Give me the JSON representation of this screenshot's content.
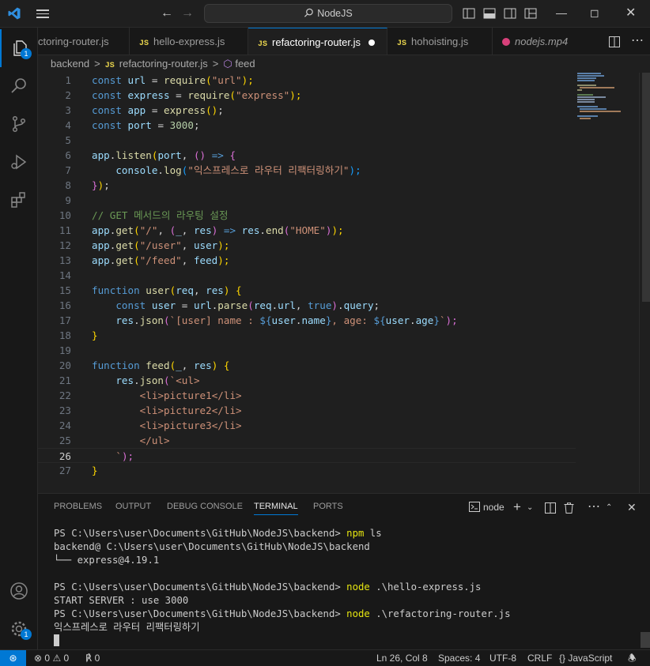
{
  "titlebar": {
    "search_label": "NodeJS",
    "back_icon": "arrow-left-icon",
    "forward_icon": "arrow-right-icon"
  },
  "activity_badges": {
    "explorer": "1",
    "manage": "1"
  },
  "tabs": [
    {
      "label": "ctoring-router.js",
      "icon": "JS"
    },
    {
      "label": "hello-express.js",
      "icon": "JS"
    },
    {
      "label": "refactoring-router.js",
      "icon": "JS"
    },
    {
      "label": "hohoisting.js",
      "icon": "JS"
    },
    {
      "label": "nodejs.mp4",
      "icon": "media"
    }
  ],
  "breadcrumb": {
    "folder": "backend",
    "file": "refactoring-router.js",
    "symbol": "feed",
    "sep": ">"
  },
  "code": {
    "line_numbers": [
      "1",
      "2",
      "3",
      "4",
      "5",
      "6",
      "7",
      "8",
      "9",
      "10",
      "11",
      "12",
      "13",
      "14",
      "15",
      "16",
      "17",
      "18",
      "19",
      "20",
      "21",
      "22",
      "23",
      "24",
      "25",
      "26",
      "27"
    ],
    "l1": {
      "kw": "const",
      "name": "url",
      "op": " = ",
      "fn": "require",
      "open": "(",
      "str": "\"url\"",
      "close": ");"
    },
    "l2": {
      "kw": "const",
      "name": "express",
      "op": " = ",
      "fn": "require",
      "open": "(",
      "str": "\"express\"",
      "close": ");"
    },
    "l3": {
      "kw": "const",
      "name": "app",
      "op": " = ",
      "fn": "express",
      "paren": "()",
      "end": ";"
    },
    "l4": {
      "kw": "const",
      "name": "port",
      "op": " = ",
      "num": "3000",
      "end": ";"
    },
    "l6": {
      "obj": "app",
      "dot": ".",
      "fn": "listen",
      "open": "(",
      "arg": "port",
      "comma": ", ",
      "p2": "()",
      "arrow": " => ",
      "brace": "{"
    },
    "l7": {
      "obj": "console",
      "dot": ".",
      "fn": "log",
      "open": "(",
      "str": "\"익스프레스로 라우터 리팩터링하기\"",
      "close": ");"
    },
    "l8": {
      "brace": "}",
      "paren": ")",
      "end": ";"
    },
    "l10": {
      "comment": "// GET 메서드의 라우팅 설정"
    },
    "l11": {
      "obj": "app",
      "dot": ".",
      "fn": "get",
      "open": "(",
      "str": "\"/\"",
      "comma": ", ",
      "p2o": "(",
      "a1": "_",
      "c2": ", ",
      "a2": "res",
      "p2c": ")",
      "arrow": " => ",
      "o2": "res",
      "dot2": ".",
      "fn2": "end",
      "p3o": "(",
      "str2": "\"HOME\"",
      "p3c": ")",
      "close": ");"
    },
    "l12": {
      "obj": "app",
      "dot": ".",
      "fn": "get",
      "open": "(",
      "str": "\"/user\"",
      "comma": ", ",
      "arg": "user",
      "close": ");"
    },
    "l13": {
      "obj": "app",
      "dot": ".",
      "fn": "get",
      "open": "(",
      "str": "\"/feed\"",
      "comma": ", ",
      "arg": "feed",
      "close": ");"
    },
    "l15": {
      "kw": "function",
      "fn": "user",
      "open": "(",
      "a1": "req",
      "comma": ", ",
      "a2": "res",
      "close": ")",
      "brace": " {"
    },
    "l16": {
      "kw": "const",
      "name": "user",
      "op": " = ",
      "obj": "url",
      "dot": ".",
      "fn": "parse",
      "open": "(",
      "a1": "req",
      "dot2": ".",
      "a2": "url",
      "comma": ", ",
      "bool": "true",
      "close": ")",
      "dot3": ".",
      "prop": "query",
      "end": ";"
    },
    "l17": {
      "obj": "res",
      "dot": ".",
      "fn": "json",
      "open": "(",
      "s1": "`[user] name : ",
      "t1o": "${",
      "t1a": "user",
      "t1d": ".",
      "t1b": "name",
      "t1c": "}",
      "s2": ", age: ",
      "t2o": "${",
      "t2a": "user",
      "t2d": ".",
      "t2b": "age",
      "t2c": "}",
      "s3": "`",
      "close": ");"
    },
    "l18": {
      "brace": "}"
    },
    "l20": {
      "kw": "function",
      "fn": "feed",
      "open": "(",
      "a1": "_",
      "comma": ", ",
      "a2": "res",
      "close": ")",
      "brace": " {"
    },
    "l21": {
      "obj": "res",
      "dot": ".",
      "fn": "json",
      "open": "(",
      "s1": "`",
      "tag": "<ul>"
    },
    "l22": {
      "lt": "<",
      "tag": "li",
      "gt": ">",
      "text": "picture1",
      "lt2": "</",
      "tag2": "li",
      "gt2": ">"
    },
    "l23": {
      "lt": "<",
      "tag": "li",
      "gt": ">",
      "text": "picture2",
      "lt2": "</",
      "tag2": "li",
      "gt2": ">"
    },
    "l24": {
      "lt": "<",
      "tag": "li",
      "gt": ">",
      "text": "picture3",
      "lt2": "</",
      "tag2": "li",
      "gt2": ">"
    },
    "l25": {
      "lt": "</",
      "tag": "ul",
      "gt": ">"
    },
    "l26": {
      "s": "`",
      "close": ");"
    },
    "l27": {
      "brace": "}"
    }
  },
  "panel": {
    "tabs": [
      "PROBLEMS",
      "OUTPUT",
      "DEBUG CONSOLE",
      "TERMINAL",
      "PORTS"
    ],
    "shell": "node",
    "terminal": [
      {
        "prompt": "PS C:\\Users\\user\\Documents\\GitHub\\NodeJS\\backend> ",
        "cmd": "npm",
        "rest": " ls"
      },
      {
        "text": "backend@ C:\\Users\\user\\Documents\\GitHub\\NodeJS\\backend"
      },
      {
        "text": "└── express@4.19.1"
      },
      {
        "text": ""
      },
      {
        "prompt": "PS C:\\Users\\user\\Documents\\GitHub\\NodeJS\\backend> ",
        "cmd": "node",
        "rest": " .\\hello-express.js"
      },
      {
        "text": "START SERVER : use 3000"
      },
      {
        "prompt": "PS C:\\Users\\user\\Documents\\GitHub\\NodeJS\\backend> ",
        "cmd": "node",
        "rest": " .\\refactoring-router.js"
      },
      {
        "text": "익스프레스로 라우터 리팩터링하기"
      }
    ]
  },
  "status": {
    "errors": "0",
    "warnings": "0",
    "ports": "0",
    "position": "Ln 26, Col 8",
    "spaces": "Spaces: 4",
    "encoding": "UTF-8",
    "eol": "CRLF",
    "language": "JavaScript",
    "lang_glyph": "{}"
  },
  "colors": {
    "accent": "#0078d4",
    "background": "#1f1f1f",
    "js_icon": "#e8d44d"
  }
}
